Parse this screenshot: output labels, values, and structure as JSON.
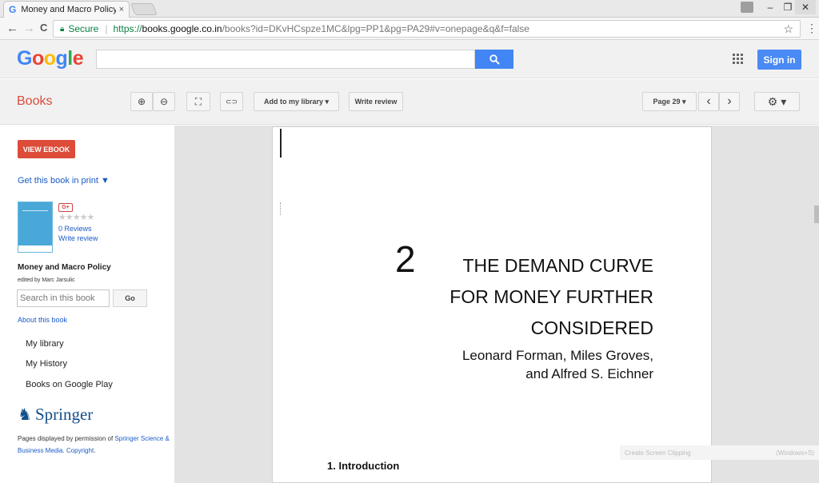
{
  "browser": {
    "tab_title": "Money and Macro Policy",
    "tab_close": "×",
    "back": "←",
    "forward": "→",
    "reload": "C",
    "secure_label": "Secure",
    "url_protocol": "https://",
    "url_host": "books.google.co.in",
    "url_path": "/books?id=DKvHCspze1MC&lpg=PP1&pg=PA29#v=onepage&q&f=false",
    "star": "☆",
    "menu": "⋮",
    "win_min": "–",
    "win_max": "❐",
    "win_close": "✕"
  },
  "google": {
    "logo_letters": [
      {
        "ch": "G",
        "color": "#4285f4"
      },
      {
        "ch": "o",
        "color": "#ea4335"
      },
      {
        "ch": "o",
        "color": "#fbbc05"
      },
      {
        "ch": "g",
        "color": "#4285f4"
      },
      {
        "ch": "l",
        "color": "#34a853"
      },
      {
        "ch": "e",
        "color": "#ea4335"
      }
    ],
    "search_value": "",
    "search_icon": "search-icon",
    "sign_in": "Sign in"
  },
  "toolbar": {
    "books_label": "Books",
    "zoom_in": "⊕",
    "zoom_out": "⊖",
    "fullscreen": "⛶",
    "link": "⊂⊃",
    "add_library": "Add to my library ▾",
    "write_review": "Write review",
    "page_select": "Page 29 ▾",
    "prev_page": "‹",
    "next_page": "›",
    "settings": "⚙ ▾"
  },
  "sidebar": {
    "view_ebook": "VIEW EBOOK",
    "get_print": "Get this book in print ▼",
    "gplus": "G+",
    "stars": "★★★★★",
    "reviews": "0 Reviews",
    "write_review": "Write review",
    "book_title": "Money and Macro Policy",
    "editor": "edited by Marc Jarsulic",
    "search_placeholder": "Search in this book",
    "go": "Go",
    "about": "About this book",
    "links": [
      "My library",
      "My History",
      "Books on Google Play"
    ],
    "publisher": "Springer",
    "permission_prefix": "Pages displayed by permission of ",
    "permission_link": "Springer Science & Business Media",
    "permission_dot": ". ",
    "copyright": "Copyright",
    "copyright_dot": "."
  },
  "page": {
    "chapter_number": "2",
    "title_lines": [
      "THE DEMAND CURVE",
      "FOR MONEY FURTHER",
      "CONSIDERED"
    ],
    "authors": [
      "Leonard Forman, Miles Groves,",
      "and Alfred S. Eichner"
    ],
    "section": "1.  Introduction"
  },
  "overlay": {
    "clipping_label": "Create Screen Clipping",
    "clipping_shortcut": "(Windows+S)"
  },
  "colors": {
    "accent_red": "#dd4b39",
    "google_blue": "#4285f4",
    "link_blue": "#1a5bc5",
    "secure_green": "#0b8043"
  }
}
